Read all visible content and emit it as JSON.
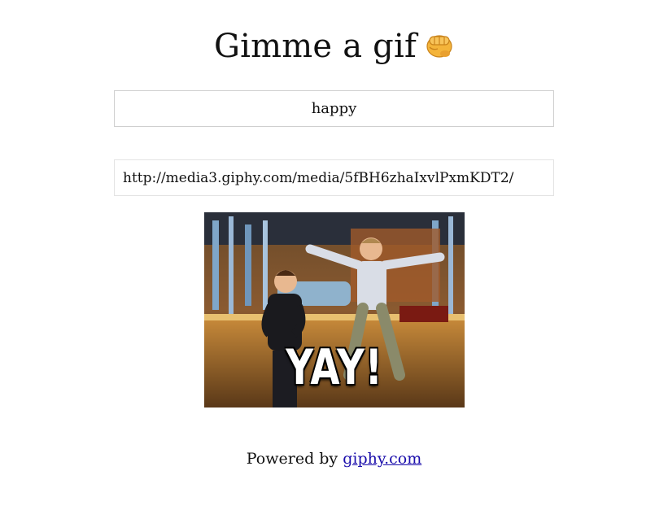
{
  "header": {
    "title": "Gimme a gif",
    "emoji_icon": "fist-bump-icon"
  },
  "search": {
    "value": "happy"
  },
  "result": {
    "url": "http://media3.giphy.com/media/5fBH6zhaIxvlPxmKDT2/",
    "gif_caption": "YAY!"
  },
  "footer": {
    "prefix": "Powered by",
    "link_text": "giphy.com"
  },
  "colors": {
    "link": "#1a0dab",
    "border": "#cfcfcf",
    "emoji": "#f4b43a"
  }
}
